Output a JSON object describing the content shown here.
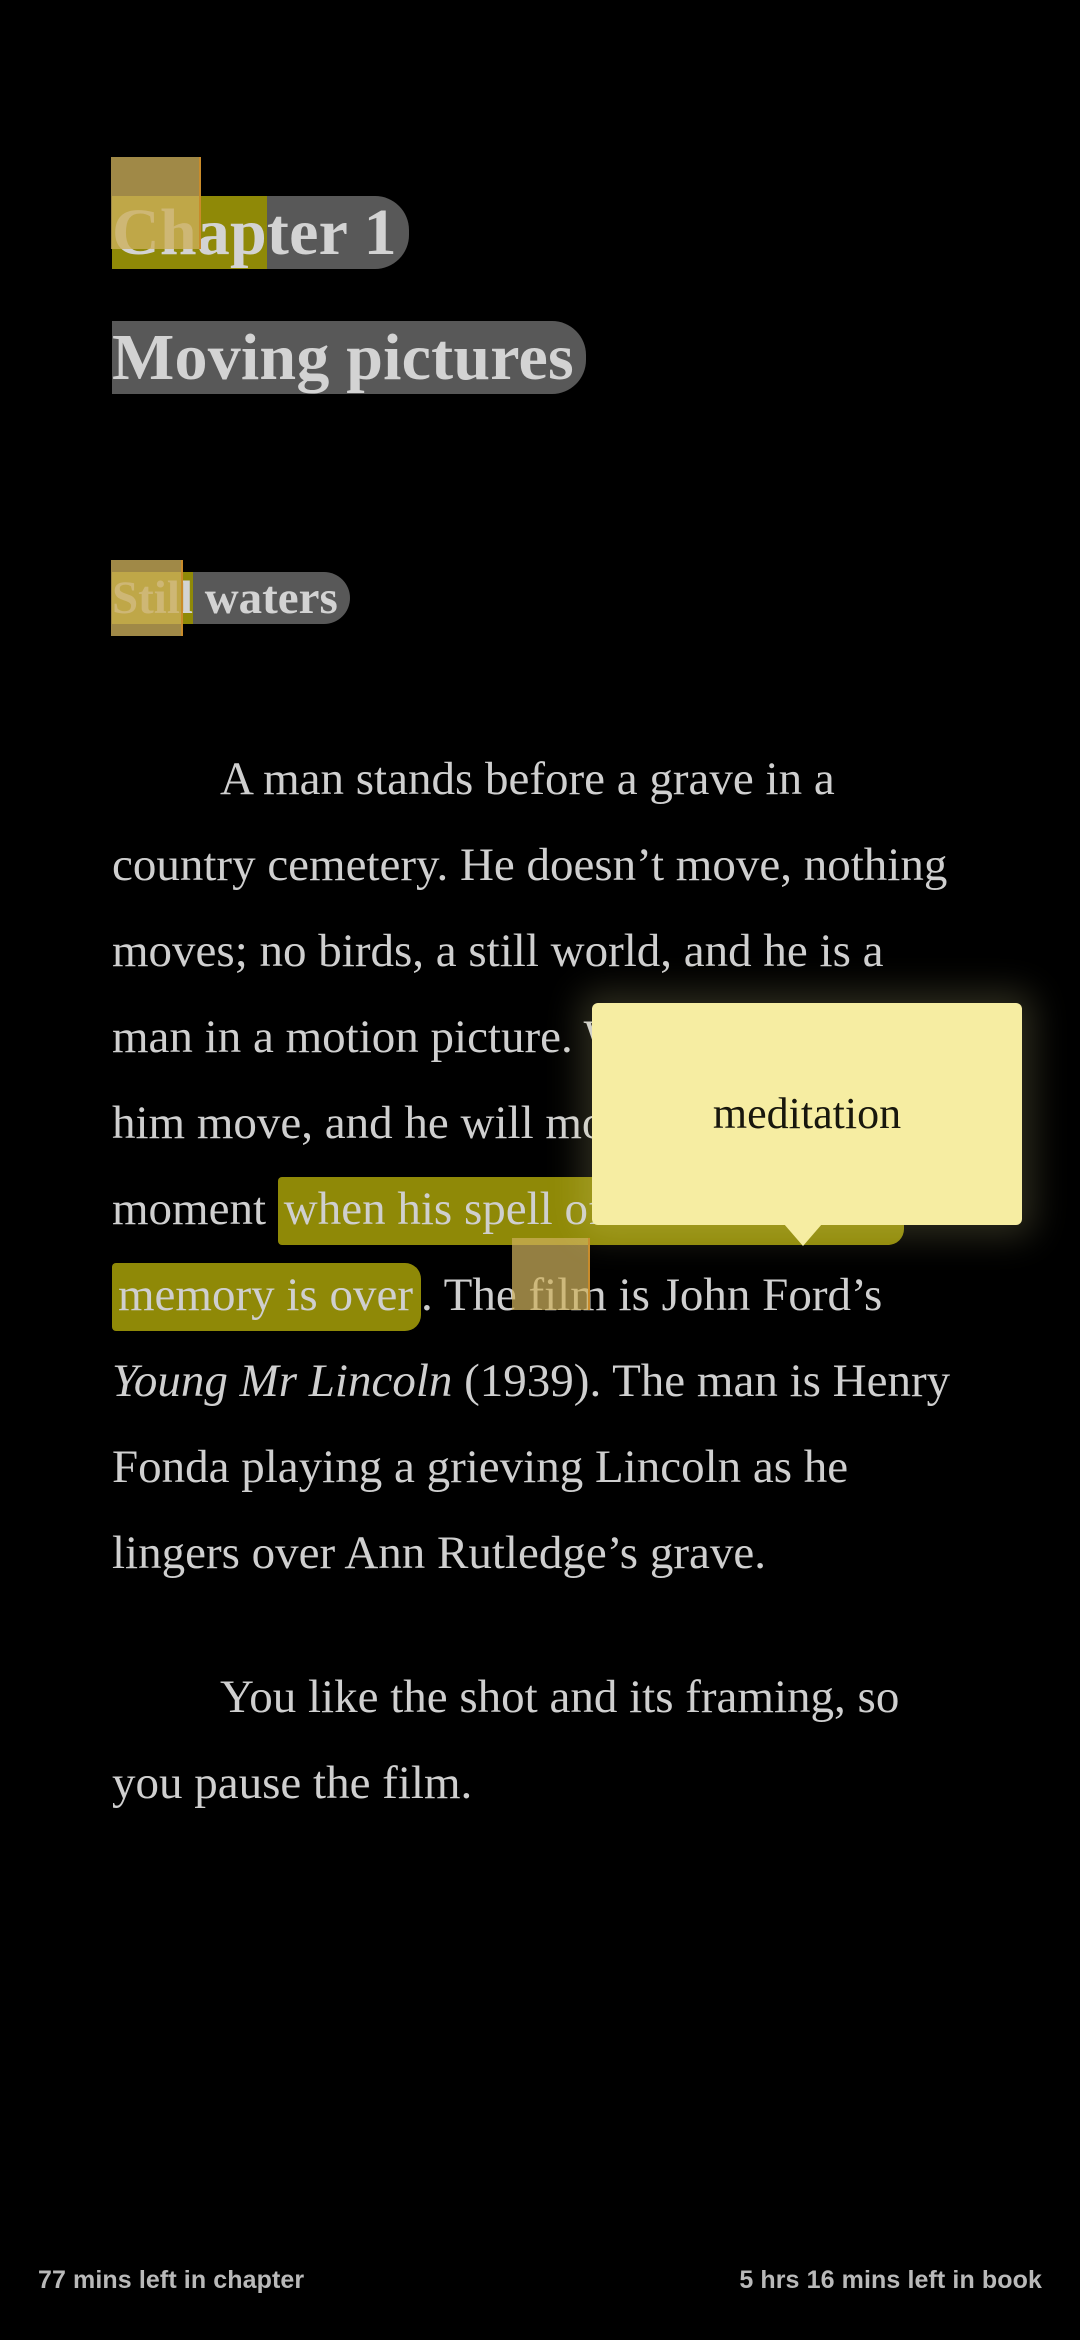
{
  "app": {
    "theme": "dark",
    "background_color": "#000000",
    "text_color": "#cfcfcf",
    "selection_color": "#585858",
    "highlight_color": "#8f8907",
    "note_color": "#f6eda2",
    "handle_color": "#cdb05b"
  },
  "heading": {
    "chapter_label": "Chapter 1",
    "chapter_label_selected_part": "Chap",
    "chapter_label_rest": "ter 1",
    "title": "Moving pictures"
  },
  "subheading": {
    "text": "Still waters",
    "highlighted_part": "Still",
    "rest": " waters"
  },
  "body": {
    "paragraph_1": {
      "before_highlight": "A man stands before a grave in a country cemetery. He doesn’t move, nothing moves; no birds, a still world, and he is a man in a motion picture. We will have seen him move, and he will move again in a moment ",
      "highlight": "when his spell of meditation and memory is over",
      "after_highlight_part_1": ". The film is John Ford’s ",
      "italic_title": "Young Mr Lincoln",
      "after_highlight_part_2": " (1939). The man is Henry Fonda playing a grieving Lincoln as he lingers over Ann Rutledge’s grave."
    },
    "paragraph_2": "You like the shot and its framing, so you pause the film."
  },
  "note_popup": {
    "text": "meditation"
  },
  "statusbar": {
    "left": "77 mins left in chapter",
    "right": "5 hrs 16 mins left in book"
  }
}
